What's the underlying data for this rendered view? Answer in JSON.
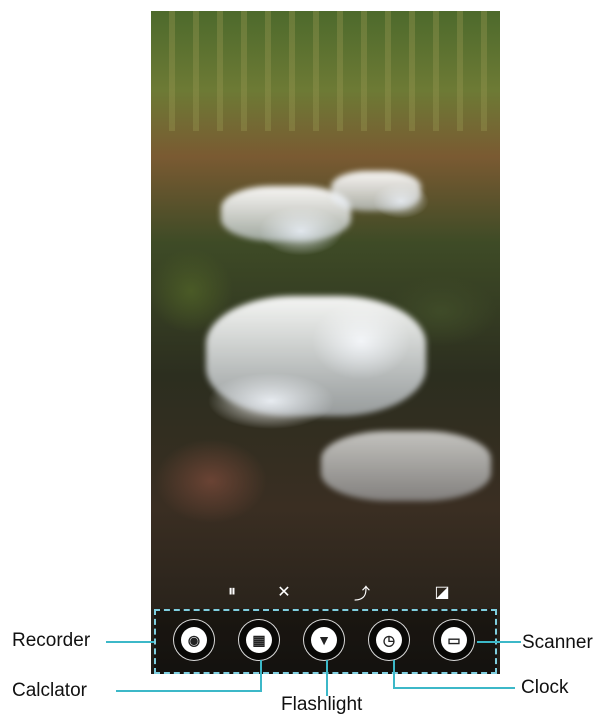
{
  "screen": {
    "wallpaper": "forest-waterfall"
  },
  "quick_controls": [
    {
      "name": "pause-icon",
      "glyph": "⏸"
    },
    {
      "name": "close-icon",
      "glyph": "✕"
    },
    {
      "name": "path-icon",
      "glyph": "⤴"
    },
    {
      "name": "screenshot-icon",
      "glyph": "◪"
    }
  ],
  "shortcuts": [
    {
      "id": "recorder",
      "label": "Recorder",
      "icon": "waveform-icon",
      "glyph": "◉"
    },
    {
      "id": "calculator",
      "label": "Calclator",
      "icon": "calculator-icon",
      "glyph": "▦"
    },
    {
      "id": "flashlight",
      "label": "Flashlight",
      "icon": "flashlight-icon",
      "glyph": "▼"
    },
    {
      "id": "clock",
      "label": "Clock",
      "icon": "clock-icon",
      "glyph": "◷"
    },
    {
      "id": "scanner",
      "label": "Scanner",
      "icon": "scanner-icon",
      "glyph": "▭"
    }
  ],
  "colors": {
    "callout_line": "#3cb8c8",
    "dock_border": "#7fcfe0"
  }
}
